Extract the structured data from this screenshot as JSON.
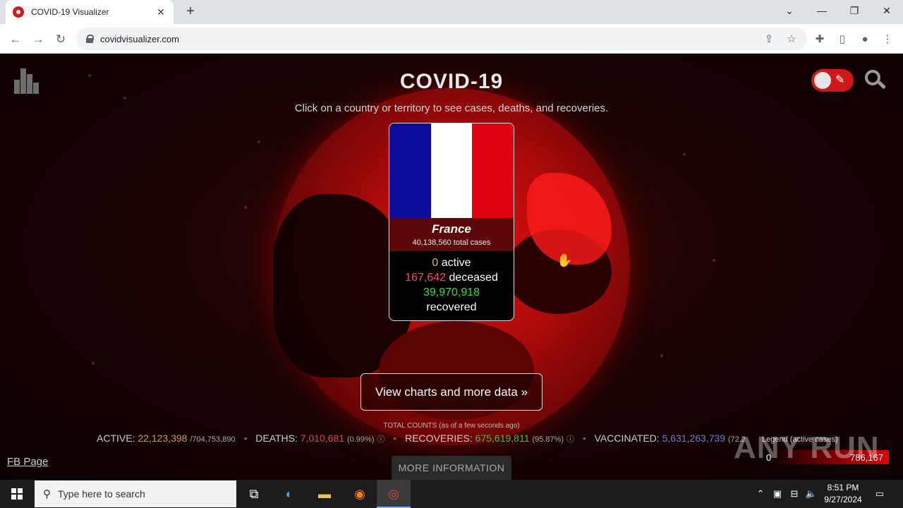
{
  "browser": {
    "tab_title": "COVID-19 Visualizer",
    "tab_close": "✕",
    "new_tab": "+",
    "url": "covidvisualizer.com"
  },
  "page": {
    "title": "COVID-19",
    "subtitle": "Click on a country or territory to see cases, deaths, and recoveries.",
    "country": {
      "name": "France",
      "flag_colors": [
        "#0d0c9a",
        "#ffffff",
        "#e1000f"
      ],
      "total_cases": "40,138,560",
      "total_cases_label": "total cases",
      "active": "0",
      "active_label": "active",
      "deceased": "167,642",
      "deceased_label": "deceased",
      "recovered": "39,970,918",
      "recovered_label": "recovered"
    },
    "charts_button": "View charts and more data »",
    "total_counts_label": "TOTAL COUNTS (as of a few seconds ago)",
    "stats": {
      "active_label": "ACTIVE:",
      "active_value": "22,123,398",
      "active_total": "/704,753,890",
      "deaths_label": "DEATHS:",
      "deaths_value": "7,010,681",
      "deaths_pct": "(0.99%)",
      "recoveries_label": "RECOVERIES:",
      "recoveries_value": "675,619,811",
      "recoveries_pct": "(95.87%)",
      "vaccinated_label": "VACCINATED:",
      "vaccinated_value": "5,631,263,739",
      "vaccinated_pct": "(72.2"
    },
    "legend_label": "Legend (active cases)",
    "legend_min": "0",
    "legend_max": "786,167",
    "fb_link": "FB Page",
    "more_info": "MORE INFORMATION",
    "watermark": "ANY RUN"
  },
  "taskbar": {
    "search_placeholder": "Type here to search",
    "time": "8:51 PM",
    "date": "9/27/2024"
  }
}
